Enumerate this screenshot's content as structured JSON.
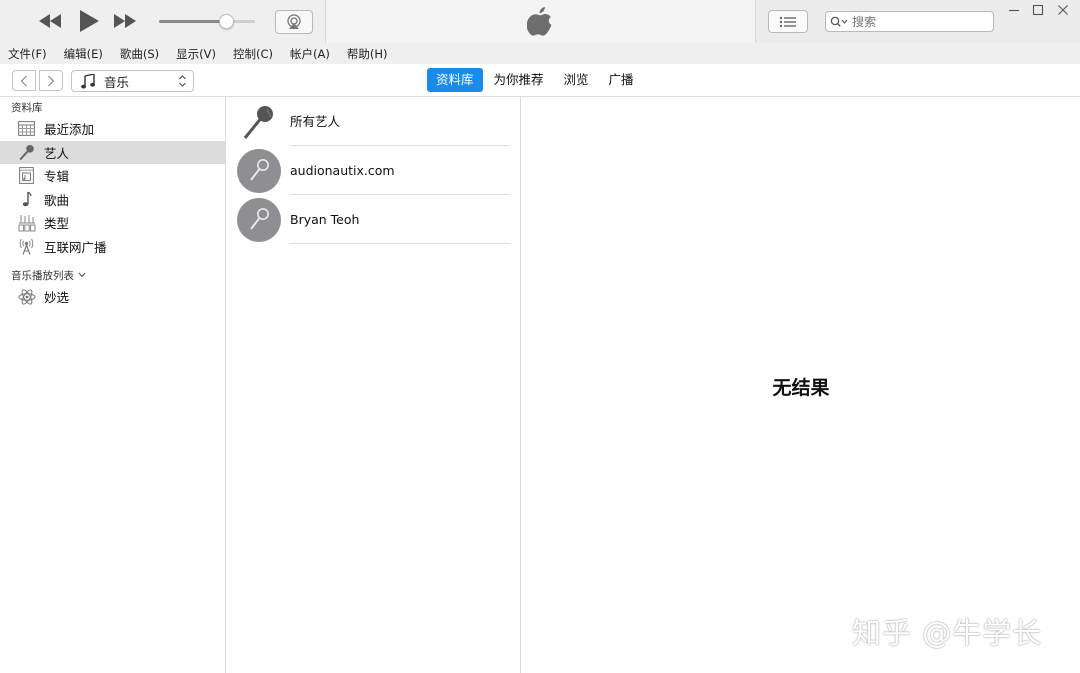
{
  "player": {
    "volume_level": 0.7,
    "search": {
      "placeholder": "搜索"
    }
  },
  "menu": {
    "items": [
      "文件(F)",
      "编辑(E)",
      "歌曲(S)",
      "显示(V)",
      "控制(C)",
      "帐户(A)",
      "帮助(H)"
    ]
  },
  "nav": {
    "media_kind": "音乐",
    "tabs": [
      {
        "label": "资料库",
        "active": true
      },
      {
        "label": "为你推荐",
        "active": false
      },
      {
        "label": "浏览",
        "active": false
      },
      {
        "label": "广播",
        "active": false
      }
    ]
  },
  "sidebar": {
    "library_title": "资料库",
    "library_items": [
      {
        "label": "最近添加",
        "icon": "calendar-grid-icon",
        "selected": false
      },
      {
        "label": "艺人",
        "icon": "microphone-icon",
        "selected": true
      },
      {
        "label": "专辑",
        "icon": "album-icon",
        "selected": false
      },
      {
        "label": "歌曲",
        "icon": "music-note-icon",
        "selected": false
      },
      {
        "label": "类型",
        "icon": "genre-icon",
        "selected": false
      },
      {
        "label": "互联网广播",
        "icon": "radio-antenna-icon",
        "selected": false
      }
    ],
    "playlists_title": "音乐播放列表",
    "playlist_items": [
      {
        "label": "妙选",
        "icon": "genius-atom-icon"
      }
    ]
  },
  "artists": {
    "items": [
      "所有艺人",
      "audionautix.com",
      "Bryan Teoh"
    ]
  },
  "detail": {
    "message": "无结果",
    "watermark": "知乎 @牛学长"
  },
  "colors": {
    "accent": "#1b8bea",
    "selected_row": "#dcdcdc",
    "avatar_gray": "#8e8e93"
  }
}
